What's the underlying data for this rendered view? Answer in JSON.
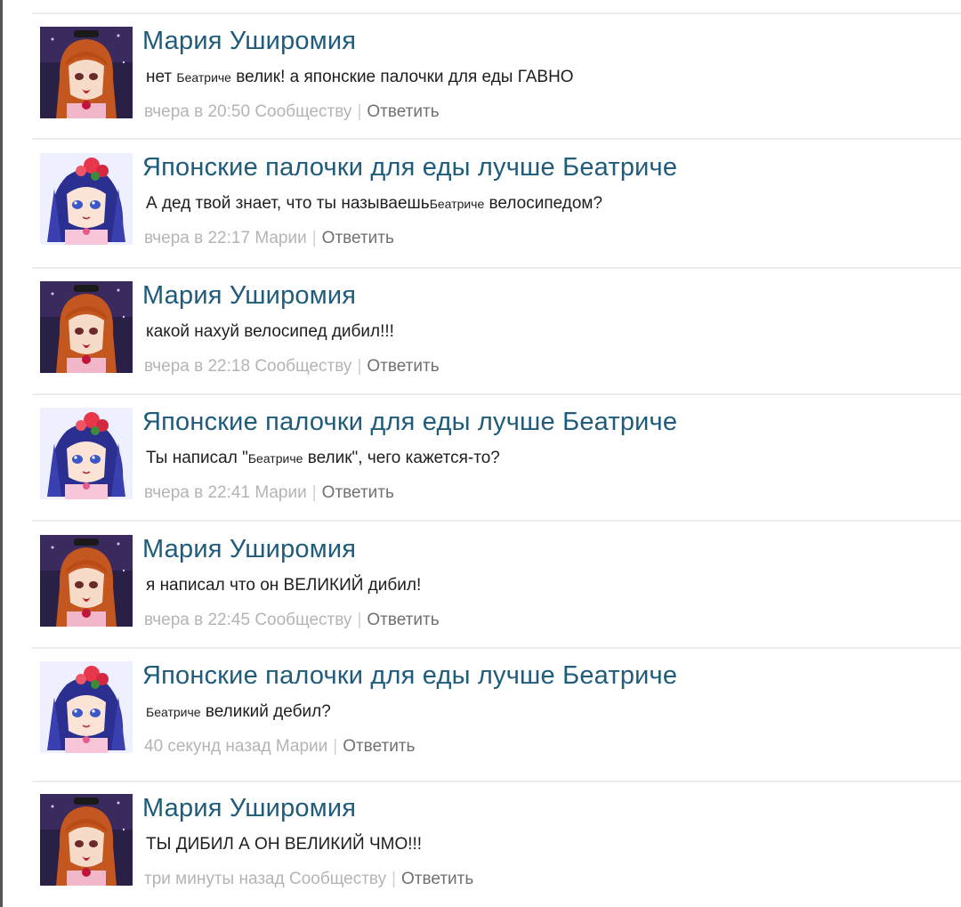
{
  "comments": [
    {
      "author": "Мария Уширомия",
      "avatar": "maria-avatar",
      "text_parts": [
        {
          "text": "нет ",
          "size": "normal"
        },
        {
          "text": "Беатриче",
          "size": "small"
        },
        {
          "text": " велик! а японские палочки для еды ГАВНО",
          "size": "normal"
        }
      ],
      "time": "вчера в 20:50",
      "recipient": "Сообществу",
      "reply_label": "Ответить"
    },
    {
      "author": "Японские палочки для еды лучше Беатриче",
      "avatar": "rika-avatar",
      "text_parts": [
        {
          "text": "А дед твой знает, что ты называешь",
          "size": "normal"
        },
        {
          "text": "Беатриче",
          "size": "small"
        },
        {
          "text": " велосипедом?",
          "size": "normal"
        }
      ],
      "time": "вчера в 22:17",
      "recipient": "Марии",
      "reply_label": "Ответить"
    },
    {
      "author": "Мария Уширомия",
      "avatar": "maria-avatar",
      "text_parts": [
        {
          "text": "какой нахуй велосипед дибил!!!",
          "size": "normal"
        }
      ],
      "time": "вчера в 22:18",
      "recipient": "Сообществу",
      "reply_label": "Ответить"
    },
    {
      "author": "Японские палочки для еды лучше Беатриче",
      "avatar": "rika-avatar",
      "text_parts": [
        {
          "text": "Ты написал \"",
          "size": "normal"
        },
        {
          "text": "Беатриче",
          "size": "small"
        },
        {
          "text": " велик\", чего кажется-то?",
          "size": "normal"
        }
      ],
      "time": "вчера в 22:41",
      "recipient": "Марии",
      "reply_label": "Ответить"
    },
    {
      "author": "Мария Уширомия",
      "avatar": "maria-avatar",
      "text_parts": [
        {
          "text": "я написал что он ВЕЛИКИЙ дибил!",
          "size": "normal"
        }
      ],
      "time": "вчера в 22:45",
      "recipient": "Сообществу",
      "reply_label": "Ответить"
    },
    {
      "author": "Японские палочки для еды лучше Беатриче",
      "avatar": "rika-avatar",
      "text_parts": [
        {
          "text": "Беатриче",
          "size": "small"
        },
        {
          "text": " великий дебил?",
          "size": "normal"
        }
      ],
      "time": "40 секунд назад",
      "recipient": "Марии",
      "reply_label": "Ответить"
    },
    {
      "author": "Мария Уширомия",
      "avatar": "maria-avatar",
      "text_parts": [
        {
          "text": "ТЫ ДИБИЛ А ОН ВЕЛИКИЙ ЧМО!!!",
          "size": "normal"
        }
      ],
      "time": "три минуты назад",
      "recipient": "Сообществу",
      "reply_label": "Ответить"
    }
  ],
  "colors": {
    "author": "#1f5b7a",
    "text": "#1e1e1e",
    "meta": "#b4b4b4",
    "reply": "#707070",
    "divider": "#ececec"
  }
}
